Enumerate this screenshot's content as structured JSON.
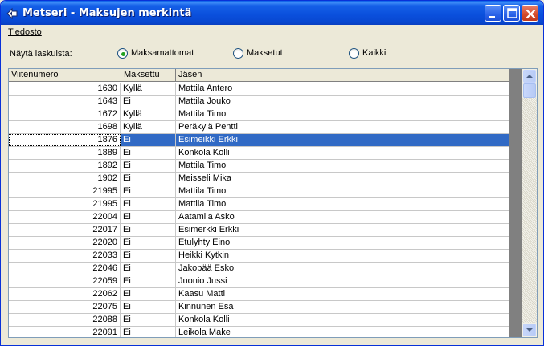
{
  "window": {
    "title": "Metseri - Maksujen merkintä",
    "icon": "app-arrow-icon",
    "controls": {
      "minimize": "minimize-icon",
      "maximize": "maximize-icon",
      "close": "close-icon"
    }
  },
  "menu": {
    "file": "Tiedosto"
  },
  "filter": {
    "label": "Näytä laskuista:",
    "options": [
      "Maksamattomat",
      "Maksetut",
      "Kaikki"
    ],
    "selected": "Maksamattomat"
  },
  "table": {
    "columns": [
      "Viitenumero",
      "Maksettu",
      "Jäsen"
    ],
    "rows": [
      [
        "1630",
        "Kyllä",
        "Mattila Antero"
      ],
      [
        "1643",
        "Ei",
        "Mattila Jouko"
      ],
      [
        "1672",
        "Kyllä",
        "Mattila Timo"
      ],
      [
        "1698",
        "Kyllä",
        "Peräkylä Pentti"
      ],
      [
        "1876",
        "Ei",
        "Esimeikki Erkki"
      ],
      [
        "1889",
        "Ei",
        "Konkola Kolli"
      ],
      [
        "1892",
        "Ei",
        "Mattila Timo"
      ],
      [
        "1902",
        "Ei",
        "Meisseli Mika"
      ],
      [
        "21995",
        "Ei",
        "Mattila Timo"
      ],
      [
        "21995",
        "Ei",
        "Mattila Timo"
      ],
      [
        "22004",
        "Ei",
        "Aatamila Asko"
      ],
      [
        "22017",
        "Ei",
        "Esimerkki Erkki"
      ],
      [
        "22020",
        "Ei",
        "Etulyhty Eino"
      ],
      [
        "22033",
        "Ei",
        "Heikki Kytkin"
      ],
      [
        "22046",
        "Ei",
        "Jakopää Esko"
      ],
      [
        "22059",
        "Ei",
        "Juonio Jussi"
      ],
      [
        "22062",
        "Ei",
        "Kaasu Matti"
      ],
      [
        "22075",
        "Ei",
        "Kinnunen Esa"
      ],
      [
        "22088",
        "Ei",
        "Konkola Kolli"
      ],
      [
        "22091",
        "Ei",
        "Leikola Make"
      ]
    ],
    "selected_row": 4
  },
  "scrollbar": {
    "up": "scroll-up-arrow-icon",
    "down": "scroll-down-arrow-icon"
  },
  "colors": {
    "selection": "#316ac5",
    "titlebar": "#0a4fdc",
    "radio_dot": "#21a121"
  }
}
